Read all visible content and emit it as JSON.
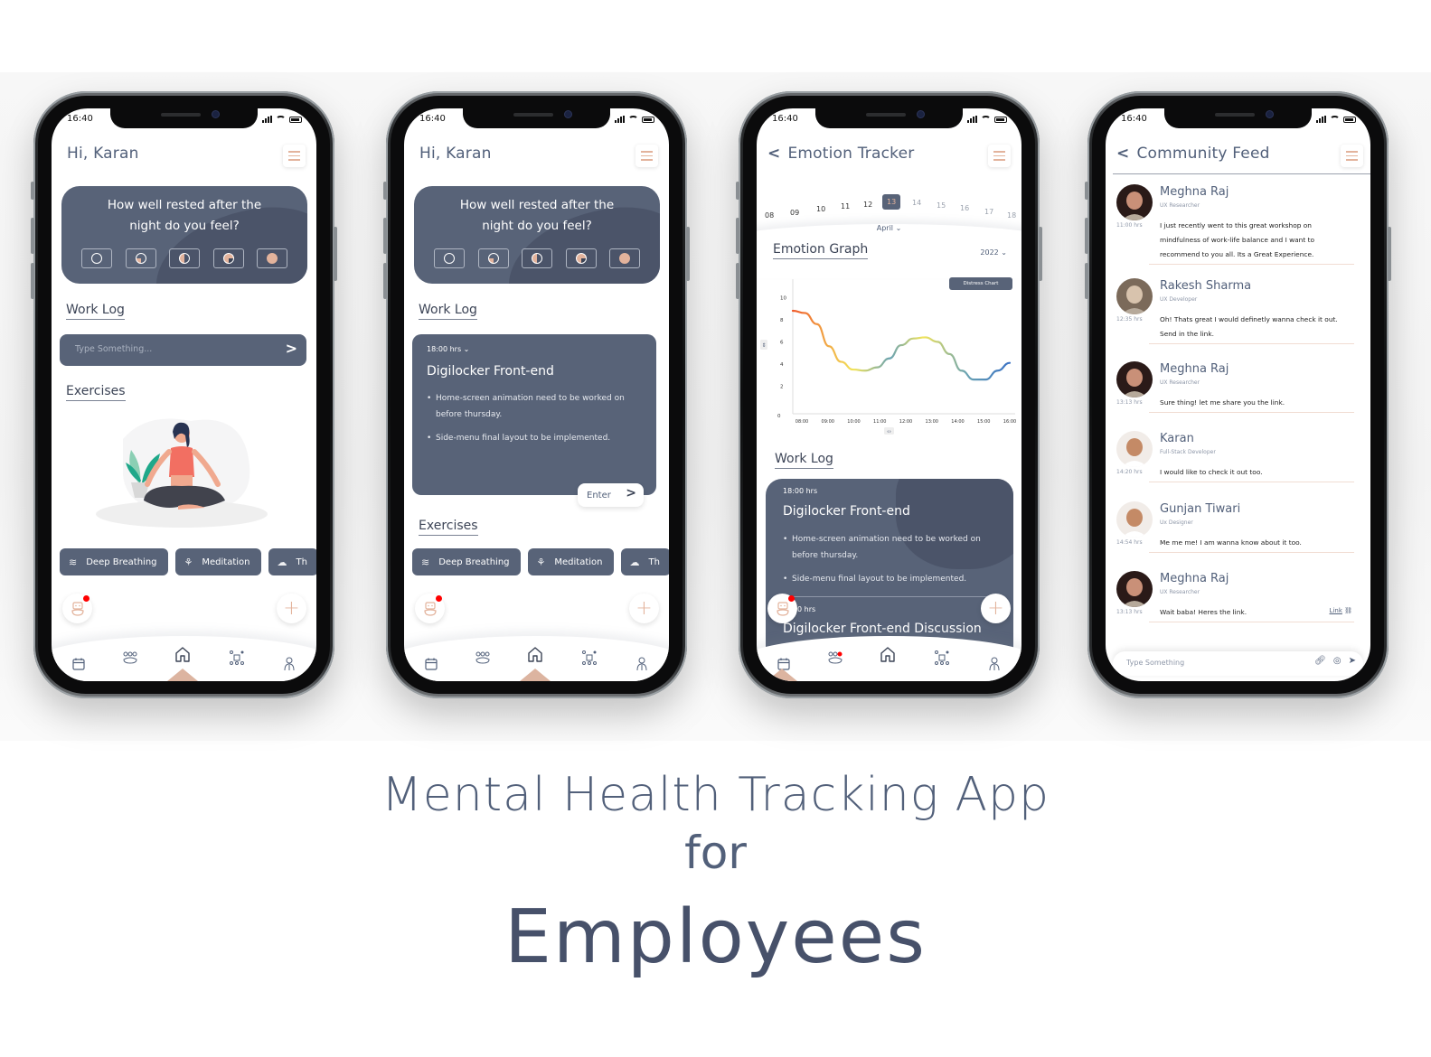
{
  "status_time": "16:40",
  "home": {
    "greeting": "Hi, Karan",
    "rest_question_line1": "How well rested after the",
    "rest_question_line2": "night do you feel?",
    "rest_options": [
      "empty",
      "quarter",
      "half",
      "three-quarter",
      "full"
    ],
    "work_log_title": "Work Log",
    "work_log_placeholder": "Type Something...",
    "exercises_title": "Exercises",
    "exercise_chips": [
      {
        "label": "Deep Breathing",
        "icon": "breathing-icon"
      },
      {
        "label": "Meditation",
        "icon": "meditation-icon"
      },
      {
        "label": "Th",
        "icon": "thought-icon"
      }
    ]
  },
  "home_expanded": {
    "greeting": "Hi, Karan",
    "rest_question_line1": "How well rested after the",
    "rest_question_line2": "night do you feel?",
    "work_log_title": "Work Log",
    "log": {
      "time": "18:00 hrs ⌄",
      "title": "Digilocker Front-end",
      "bullets": [
        "Home-screen animation need to be worked on before thursday.",
        "Side-menu final layout to be implemented."
      ],
      "enter_label": "Enter"
    },
    "exercises_title": "Exercises",
    "exercise_chips": [
      {
        "label": "Deep Breathing"
      },
      {
        "label": "Meditation"
      },
      {
        "label": "Th"
      }
    ]
  },
  "emotion": {
    "title": "Emotion Tracker",
    "dates": [
      "08",
      "09",
      "10",
      "11",
      "12",
      "13",
      "14",
      "15",
      "16",
      "17",
      "18"
    ],
    "selected_date": "13",
    "month": "April ⌄",
    "graph_title": "Emotion Graph",
    "year": "2022 ⌄",
    "distress_button": "Distress Chart",
    "work_log_title": "Work Log",
    "log": {
      "time": "18:00 hrs",
      "title": "Digilocker Front-end",
      "bullets": [
        "Home-screen animation need to be worked on before thursday.",
        "Side-menu final layout to be implemented."
      ],
      "time2": "0 hrs",
      "title2": "Digilocker Front-end Discussion"
    }
  },
  "chart_data": {
    "type": "line",
    "title": "Emotion Graph",
    "xlabel": "",
    "ylabel": "",
    "x": [
      "07:30",
      "08:00",
      "08:30",
      "09:00",
      "09:30",
      "10:00",
      "10:30",
      "11:00",
      "11:30",
      "12:00",
      "12:30",
      "13:00",
      "13:30",
      "14:00",
      "14:30",
      "15:00",
      "15:30",
      "16:00",
      "16:15"
    ],
    "x_ticks": [
      "08:00",
      "09:00",
      "10:00",
      "11:00",
      "12:00",
      "13:00",
      "14:00",
      "15:00",
      "16:00"
    ],
    "y_ticks": [
      "0",
      "2",
      "4",
      "6",
      "8",
      "10"
    ],
    "values": [
      8.8,
      8.6,
      7.6,
      5.6,
      4.2,
      3.5,
      3.4,
      3.7,
      4.5,
      5.7,
      6.3,
      6.4,
      6.0,
      4.9,
      3.4,
      2.6,
      2.6,
      3.4,
      4.1
    ],
    "ylim": [
      0,
      11
    ],
    "grid": false,
    "gradient": [
      "#f05a2a",
      "#f2e45a",
      "#6aa3b2",
      "#3a72c4"
    ]
  },
  "community": {
    "title": "Community Feed",
    "posts": [
      {
        "name": "Meghna Raj",
        "role": "UX Researcher",
        "time": "11:00 hrs",
        "message": "I just recently went to this great workshop on mindfulness of work-life balance and I want to recommend to you all. Its a Great Experience."
      },
      {
        "name": "Rakesh Sharma",
        "role": "UX Developer",
        "time": "12:35 hrs",
        "message": "Oh! Thats great I would definetly wanna check it out. Send in the link."
      },
      {
        "name": "Meghna Raj",
        "role": "UX Researcher",
        "time": "13:13 hrs",
        "message": "Sure thing! let me share you the link."
      },
      {
        "name": "Karan",
        "role": "Full-Stack Developer",
        "time": "14:20 hrs",
        "message": "I would like to check it out too."
      },
      {
        "name": "Gunjan Tiwari",
        "role": "Ux Designer",
        "time": "14:54 hrs",
        "message": "Me me me! I am wanna know about it too."
      },
      {
        "name": "Meghna Raj",
        "role": "UX Researcher",
        "time": "13:13 hrs",
        "message": "Wait baba! Heres the link.",
        "link_label": "Link"
      }
    ],
    "input_placeholder": "Type Something"
  },
  "nav_items": [
    "calendar-icon",
    "community-icon",
    "home-icon",
    "network-icon",
    "profile-icon"
  ],
  "footer": {
    "line1": "Mental Health Tracking App",
    "line2": "for",
    "line3": "Employees"
  },
  "colors": {
    "primary": "#586378",
    "accent": "#e3b39c",
    "text": "#52607a",
    "notification": "#ff0000"
  }
}
